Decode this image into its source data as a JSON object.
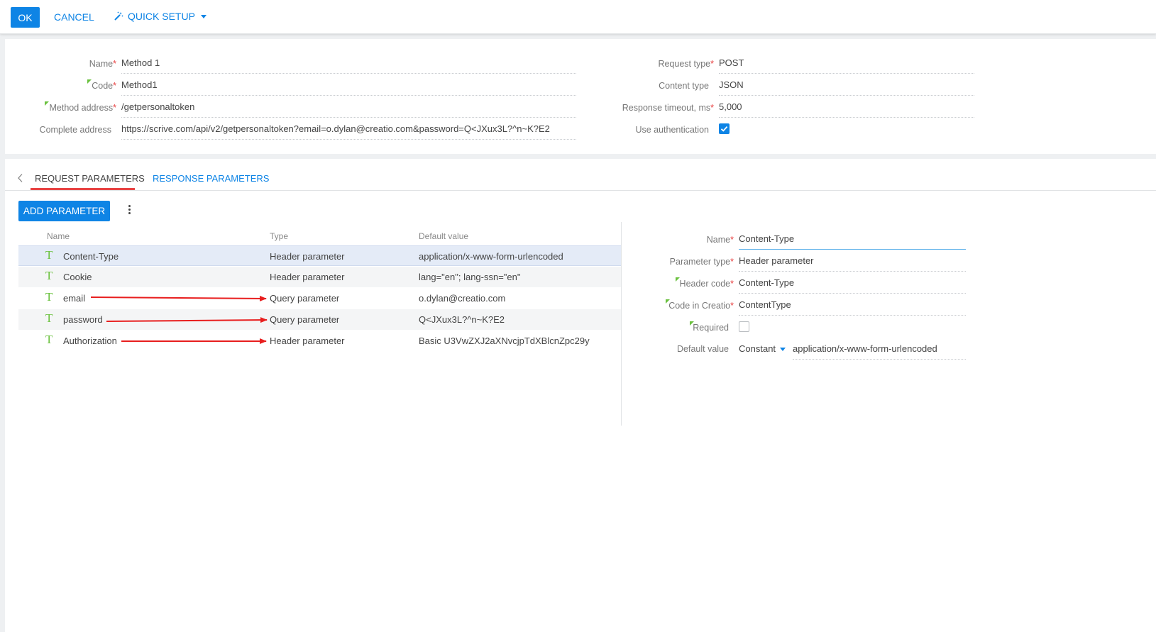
{
  "toolbar": {
    "ok_label": "OK",
    "cancel_label": "CANCEL",
    "quick_setup_label": "QUICK SETUP",
    "accent_color": "#0e84e5"
  },
  "method": {
    "name_label": "Name",
    "name_value": "Method 1",
    "code_label": "Code",
    "code_value": "Method1",
    "address_label": "Method address",
    "address_value": "/getpersonaltoken",
    "complete_label": "Complete address",
    "complete_value": "https://scrive.com/api/v2/getpersonaltoken?email=o.dylan@creatio.com&password=Q<JXux3L?^n~K?E2",
    "request_type_label": "Request type",
    "request_type_value": "POST",
    "content_type_label": "Content type",
    "content_type_value": "JSON",
    "timeout_label": "Response timeout, ms",
    "timeout_value": "5,000",
    "auth_label": "Use authentication",
    "auth_checked": true,
    "required_marker": "*"
  },
  "tabs": [
    {
      "label": "REQUEST PARAMETERS",
      "active": true
    },
    {
      "label": "RESPONSE PARAMETERS",
      "active": false
    }
  ],
  "params": {
    "add_button_label": "ADD PARAMETER",
    "columns": [
      "Name",
      "Type",
      "Default value"
    ],
    "type_icon": "T",
    "rows": [
      {
        "name": "Content-Type",
        "type": "Header parameter",
        "default": "application/x-www-form-urlencoded"
      },
      {
        "name": "Cookie",
        "type": "Header parameter",
        "default": "lang=\"en\"; lang-ssn=\"en\""
      },
      {
        "name": "email",
        "type": "Query parameter",
        "default": "o.dylan@creatio.com"
      },
      {
        "name": "password",
        "type": "Query parameter",
        "default": "Q<JXux3L?^n~K?E2"
      },
      {
        "name": "Authorization",
        "type": "Header parameter",
        "default": "Basic U3VwZXJ2aXNvcjpTdXBlcnZpc29y"
      }
    ]
  },
  "detail": {
    "name_label": "Name",
    "name_value": "Content-Type",
    "ptype_label": "Parameter type",
    "ptype_value": "Header parameter",
    "hcode_label": "Header code",
    "hcode_value": "Content-Type",
    "ccode_label": "Code in Creatio",
    "ccode_value": "ContentType",
    "required_label": "Required",
    "required_checked": false,
    "default_label": "Default value",
    "default_mode": "Constant",
    "default_value": "application/x-www-form-urlencoded"
  },
  "colors": {
    "required": "#e84343",
    "annotation_arrow": "#e81e1e",
    "type_icon": "#6ac13e"
  }
}
